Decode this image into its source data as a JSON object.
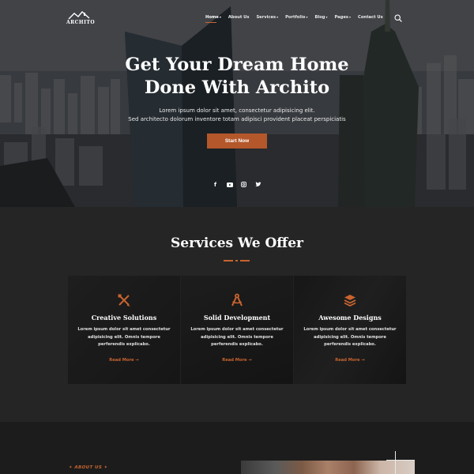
{
  "brand": {
    "logo_text": "ARCHITO"
  },
  "nav": {
    "items": [
      {
        "label": "Home",
        "dropdown": true,
        "active": true
      },
      {
        "label": "About Us",
        "dropdown": false
      },
      {
        "label": "Services",
        "dropdown": true
      },
      {
        "label": "Portfolio",
        "dropdown": true
      },
      {
        "label": "Blog",
        "dropdown": true
      },
      {
        "label": "Pages",
        "dropdown": true
      },
      {
        "label": "Contact Us",
        "dropdown": false
      }
    ],
    "search_icon": "search-icon"
  },
  "hero": {
    "title_line1": "Get Your Dream Home",
    "title_line2": "Done With Archito",
    "sub_line1": "Lorem ipsum dolor sit amet, consectetur adipisicing elit.",
    "sub_line2": "Sed architecto dolorum inventore totam adipisci provident placeat perspiciatis",
    "cta_label": "Start Now",
    "socials": [
      "facebook-icon",
      "youtube-icon",
      "instagram-icon",
      "twitter-icon"
    ]
  },
  "services": {
    "title": "Services We Offer",
    "cards": [
      {
        "icon": "pencil-ruler-icon",
        "title": "Creative Solutions",
        "text": "Lorem ipsum dolor sit amet consectetur adipisicing elit. Omnis tempore perferendis explicabo.",
        "link": "Read More"
      },
      {
        "icon": "compass-icon",
        "title": "Solid Development",
        "text": "Lorem ipsum dolor sit amet consectetur adipisicing elit. Omnis tempore perferendis explicabo.",
        "link": "Read More"
      },
      {
        "icon": "layers-icon",
        "title": "Awesome Designs",
        "text": "Lorem ipsum dolor sit amet consectetur adipisicing elit. Omnis tempore perferendis explicabo.",
        "link": "Read More"
      }
    ]
  },
  "about": {
    "label": "ABOUT US"
  },
  "colors": {
    "accent": "#c8642e",
    "button": "#b4572a",
    "dark_bg": "#252525",
    "card_bg": "#171717"
  }
}
